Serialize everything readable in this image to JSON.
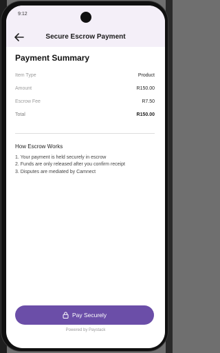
{
  "status_bar": {
    "time": "9:12"
  },
  "header": {
    "title": "Secure Escrow Payment",
    "back_icon": "arrow-left-icon"
  },
  "summary": {
    "title": "Payment Summary",
    "rows": [
      {
        "label": "Item Type",
        "value": "Product"
      },
      {
        "label": "Amount",
        "value": "R150.00"
      },
      {
        "label": "Escrow Fee",
        "value": "R7.50"
      },
      {
        "label": "Total",
        "value": "R150.00"
      }
    ]
  },
  "how_escrow": {
    "title": "How Escrow Works",
    "steps": [
      "1. Your payment is held securely in escrow",
      "2. Funds are only released after you confirm receipt",
      "3. Disputes are mediated by Camnect"
    ]
  },
  "pay_button": {
    "label": "Pay Securely",
    "icon": "lock-icon",
    "color": "#6b4ea8"
  },
  "footer": {
    "powered_by": "Powered by Paystack"
  }
}
